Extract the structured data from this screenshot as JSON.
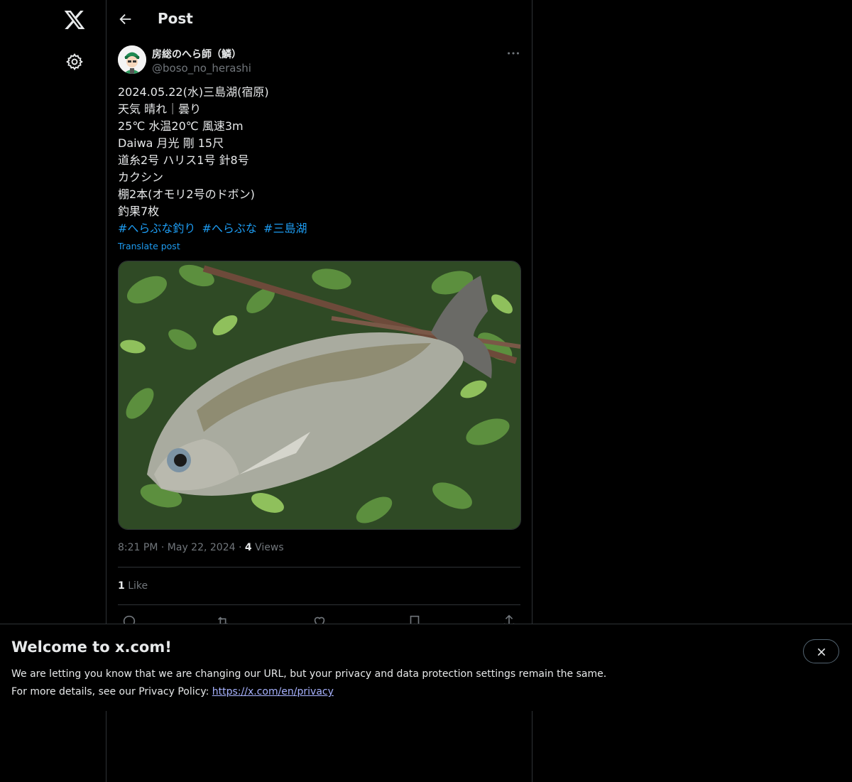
{
  "header": {
    "title": "Post"
  },
  "author": {
    "display_name": "房総のへら師（鱗）",
    "handle": "@boso_no_herashi"
  },
  "tweet": {
    "lines": [
      "2024.05.22(水)三島湖(宿原)",
      "天気 晴れ｜曇り",
      "25℃ 水温20℃ 風速3m",
      "Daiwa 月光 剛 15尺",
      "道糸2号 ハリス1号 針8号",
      "カクシン",
      "棚2本(オモリ2号のドボン)",
      "釣果7枚"
    ],
    "hashtags": [
      "#へらぶな釣り",
      "#へらぶな",
      "#三島湖"
    ],
    "translate_label": "Translate post"
  },
  "meta": {
    "time": "8:21 PM",
    "date": "May 22, 2024",
    "views_count": "4",
    "views_label": "Views"
  },
  "engagement": {
    "likes_count": "1",
    "likes_label": "Like"
  },
  "banner": {
    "title": "Welcome to x.com!",
    "line1": "We are letting you know that we are changing our URL, but your privacy and data protection settings remain the same.",
    "line2_prefix": "For more details, see our Privacy Policy: ",
    "link": "https://x.com/en/privacy"
  },
  "icons": {
    "logo": "x-logo-icon",
    "settings": "gear-icon",
    "back": "arrow-left-icon",
    "more": "more-horizontal-icon",
    "reply": "reply-icon",
    "retweet": "retweet-icon",
    "like": "heart-icon",
    "bookmark": "bookmark-icon",
    "share": "share-icon",
    "close": "close-icon"
  },
  "colors": {
    "background": "#000000",
    "text": "#e7e9ea",
    "muted": "#71767b",
    "accent": "#1d9bf0"
  }
}
